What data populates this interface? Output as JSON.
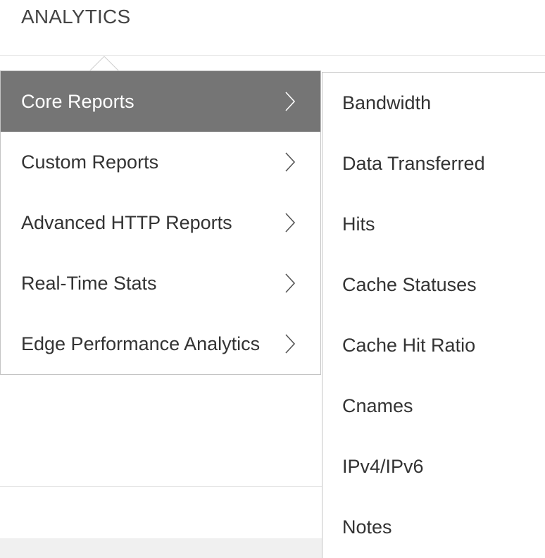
{
  "header": {
    "title": "ANALYTICS"
  },
  "main_menu": {
    "items": [
      {
        "label": "Core Reports",
        "active": true
      },
      {
        "label": "Custom Reports",
        "active": false
      },
      {
        "label": "Advanced HTTP Reports",
        "active": false
      },
      {
        "label": "Real-Time Stats",
        "active": false
      },
      {
        "label": "Edge Performance Analytics",
        "active": false
      }
    ],
    "icons": {
      "submenu_indicator": "chevron-right-icon"
    }
  },
  "sub_menu": {
    "items": [
      {
        "label": "Bandwidth"
      },
      {
        "label": "Data Transferred"
      },
      {
        "label": "Hits"
      },
      {
        "label": "Cache Statuses"
      },
      {
        "label": "Cache Hit Ratio"
      },
      {
        "label": "Cnames"
      },
      {
        "label": "IPv4/IPv6"
      },
      {
        "label": "Notes"
      }
    ]
  },
  "colors": {
    "active_background": "#757575",
    "active_text": "#ffffff",
    "text": "#333333",
    "border": "#c4c4c4"
  }
}
